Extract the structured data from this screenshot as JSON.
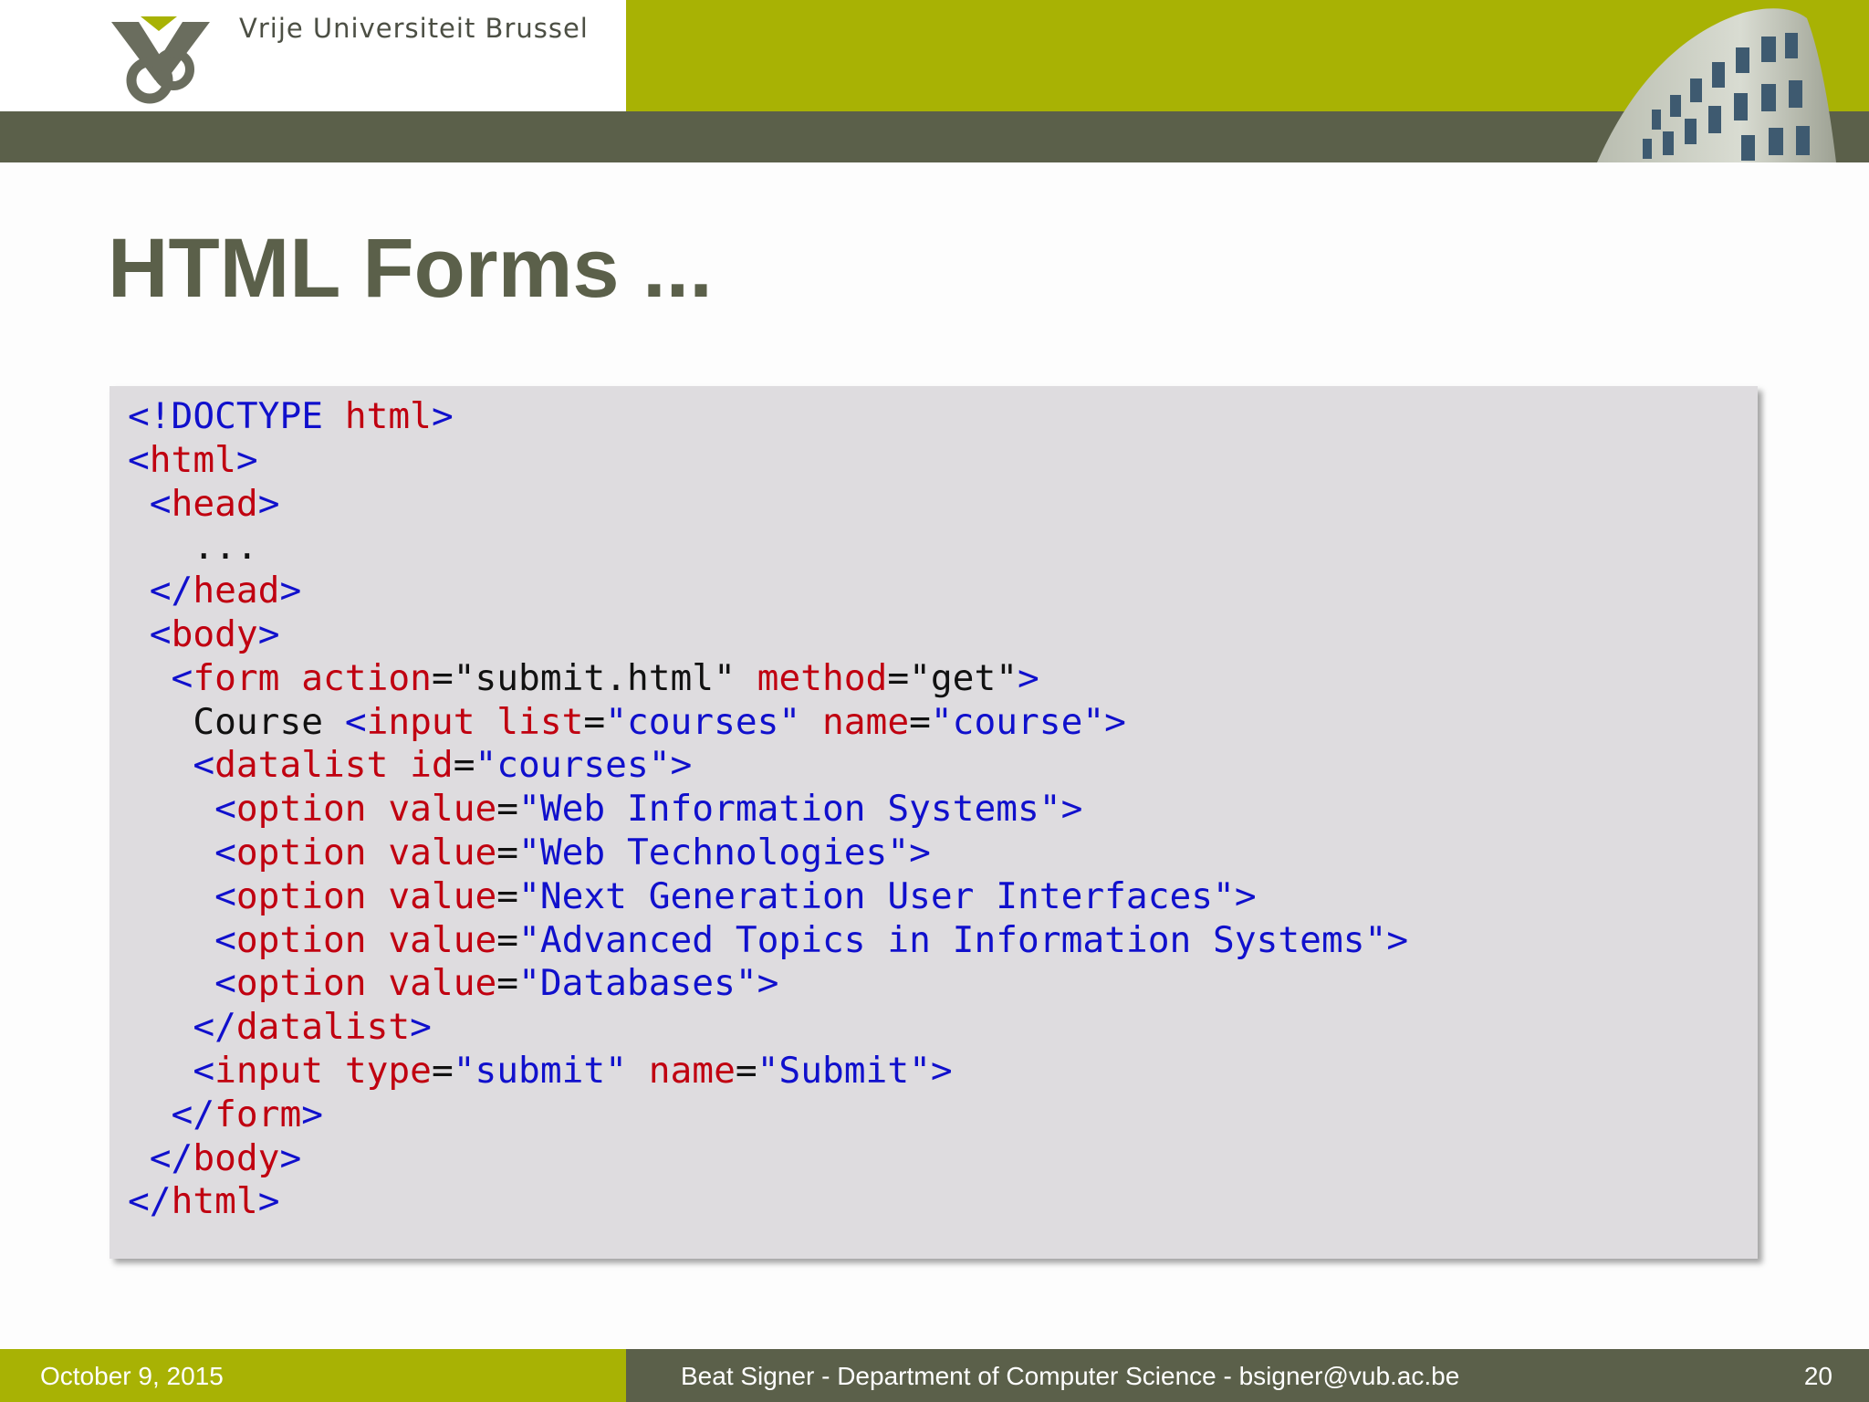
{
  "header": {
    "university": "Vrije Universiteit  Brussel",
    "logo_icon": "vub-logo-icon",
    "image": "building-photo"
  },
  "slide": {
    "title": "HTML Forms ..."
  },
  "code_lines": [
    [
      [
        "<!DOCTYPE ",
        "blue"
      ],
      [
        "html",
        "red"
      ],
      [
        ">",
        "blue"
      ]
    ],
    [
      [
        "<",
        "blue"
      ],
      [
        "html",
        "red"
      ],
      [
        ">",
        "blue"
      ]
    ],
    [
      [
        " <",
        "blue"
      ],
      [
        "head",
        "red"
      ],
      [
        ">",
        "blue"
      ]
    ],
    [
      [
        "   ...",
        "black"
      ]
    ],
    [
      [
        " </",
        "blue"
      ],
      [
        "head",
        "red"
      ],
      [
        ">",
        "blue"
      ]
    ],
    [
      [
        " <",
        "blue"
      ],
      [
        "body",
        "red"
      ],
      [
        ">",
        "blue"
      ]
    ],
    [
      [
        "  <",
        "blue"
      ],
      [
        "form ",
        "red"
      ],
      [
        "action",
        "red"
      ],
      [
        "=\"submit.html\" ",
        "black"
      ],
      [
        "method",
        "red"
      ],
      [
        "=\"get\"",
        "black"
      ],
      [
        ">",
        "blue"
      ]
    ],
    [
      [
        "   Course ",
        "black"
      ],
      [
        "<",
        "blue"
      ],
      [
        "input ",
        "red"
      ],
      [
        "list",
        "red"
      ],
      [
        "=",
        "black"
      ],
      [
        "\"courses\" ",
        "blue"
      ],
      [
        "name",
        "red"
      ],
      [
        "=",
        "black"
      ],
      [
        "\"course\"",
        "blue"
      ],
      [
        ">",
        "blue"
      ]
    ],
    [
      [
        "   <",
        "blue"
      ],
      [
        "datalist ",
        "red"
      ],
      [
        "id",
        "red"
      ],
      [
        "=",
        "black"
      ],
      [
        "\"courses\"",
        "blue"
      ],
      [
        ">",
        "blue"
      ]
    ],
    [
      [
        "    <",
        "blue"
      ],
      [
        "option ",
        "red"
      ],
      [
        "value",
        "red"
      ],
      [
        "=",
        "black"
      ],
      [
        "\"Web Information Systems\"",
        "blue"
      ],
      [
        ">",
        "blue"
      ]
    ],
    [
      [
        "    <",
        "blue"
      ],
      [
        "option ",
        "red"
      ],
      [
        "value",
        "red"
      ],
      [
        "=",
        "black"
      ],
      [
        "\"Web Technologies\"",
        "blue"
      ],
      [
        ">",
        "blue"
      ]
    ],
    [
      [
        "    <",
        "blue"
      ],
      [
        "option ",
        "red"
      ],
      [
        "value",
        "red"
      ],
      [
        "=",
        "black"
      ],
      [
        "\"Next Generation User Interfaces\"",
        "blue"
      ],
      [
        ">",
        "blue"
      ]
    ],
    [
      [
        "    <",
        "blue"
      ],
      [
        "option ",
        "red"
      ],
      [
        "value",
        "red"
      ],
      [
        "=",
        "black"
      ],
      [
        "\"Advanced Topics in Information Systems\"",
        "blue"
      ],
      [
        ">",
        "blue"
      ]
    ],
    [
      [
        "    <",
        "blue"
      ],
      [
        "option ",
        "red"
      ],
      [
        "value",
        "red"
      ],
      [
        "=",
        "black"
      ],
      [
        "\"Databases\"",
        "blue"
      ],
      [
        ">",
        "blue"
      ]
    ],
    [
      [
        "   </",
        "blue"
      ],
      [
        "datalist",
        "red"
      ],
      [
        ">",
        "blue"
      ]
    ],
    [
      [
        "   <",
        "blue"
      ],
      [
        "input ",
        "red"
      ],
      [
        "type",
        "red"
      ],
      [
        "=",
        "black"
      ],
      [
        "\"submit\" ",
        "blue"
      ],
      [
        "name",
        "red"
      ],
      [
        "=",
        "black"
      ],
      [
        "\"Submit\"",
        "blue"
      ],
      [
        ">",
        "blue"
      ]
    ],
    [
      [
        "  </",
        "blue"
      ],
      [
        "form",
        "red"
      ],
      [
        ">",
        "blue"
      ]
    ],
    [
      [
        " </",
        "blue"
      ],
      [
        "body",
        "red"
      ],
      [
        ">",
        "blue"
      ]
    ],
    [
      [
        "</",
        "blue"
      ],
      [
        "html",
        "red"
      ],
      [
        ">",
        "blue"
      ]
    ]
  ],
  "footer": {
    "date": "October 9, 2015",
    "author": "Beat Signer - Department of Computer Science - bsigner@vub.ac.be",
    "page": "20"
  },
  "colors": {
    "olive": "#a8b204",
    "dark": "#5b604a",
    "code_bg": "#dedcdf",
    "tag": "#1010cc",
    "keyword": "#c00010"
  }
}
